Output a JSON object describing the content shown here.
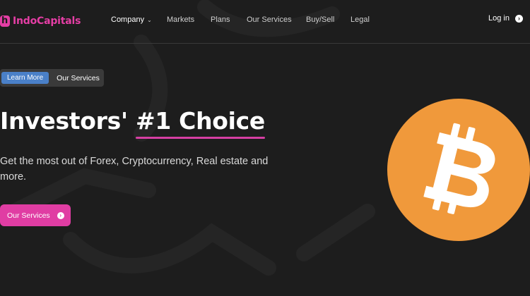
{
  "brand": {
    "logo_letter": "h",
    "name": "IndoCapitals",
    "color": "#e53ea5"
  },
  "nav": {
    "items": [
      {
        "label": "Company",
        "has_dropdown": true,
        "active": true
      },
      {
        "label": "Markets"
      },
      {
        "label": "Plans"
      },
      {
        "label": "Our Services"
      },
      {
        "label": "Buy/Sell"
      },
      {
        "label": "Legal"
      }
    ],
    "login_label": "Log in"
  },
  "hero": {
    "pill_primary": "Learn More",
    "pill_secondary": "Our Services",
    "title_plain": "Investors' ",
    "title_highlight": "#1 Choice",
    "subtitle": "Get the most out of Forex, Cryptocurrency, Real estate and more.",
    "cta_label": "Our Services"
  },
  "icons": [
    "chevron-down-icon",
    "arrow-circle-right-icon",
    "bitcoin-icon"
  ],
  "colors": {
    "accent": "#e03da3",
    "pill_blue": "#4a80c8",
    "bitcoin": "#f0993b",
    "background": "#1d1d1d"
  }
}
